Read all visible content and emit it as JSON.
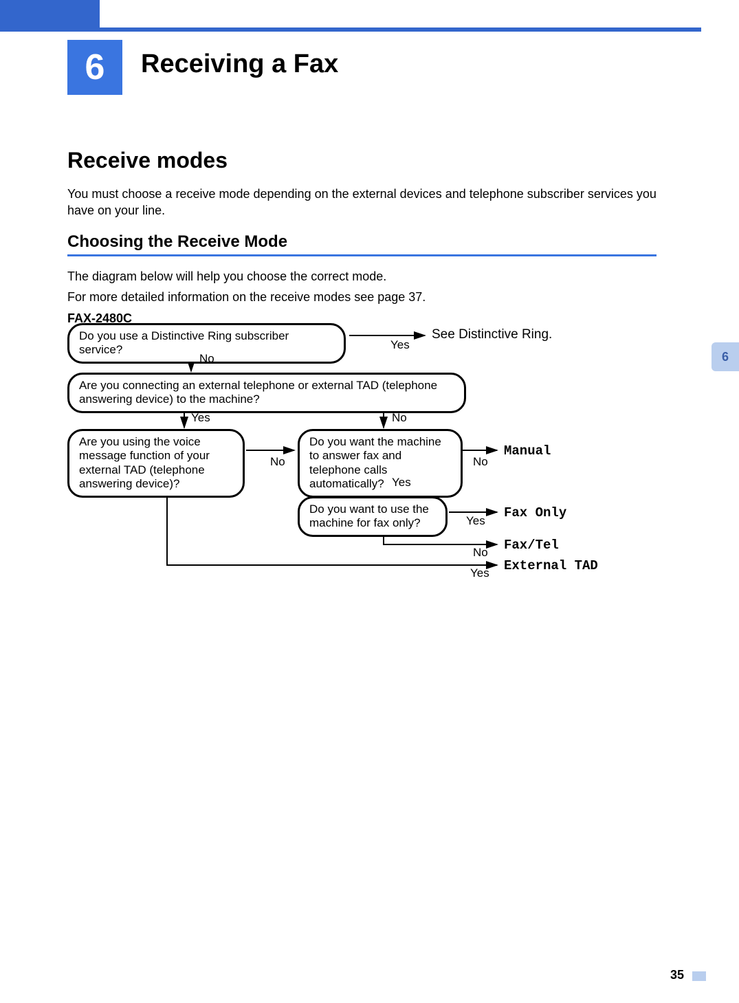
{
  "chapter": {
    "number": "6",
    "title": "Receiving a Fax"
  },
  "h2": "Receive modes",
  "intro": "You must choose a receive mode depending on the external devices and telephone subscriber services you have on your line.",
  "h3": "Choosing the Receive Mode",
  "p1": "The diagram below will help you choose the correct mode.",
  "p2": "For more detailed information on the receive modes see page 37.",
  "model": "FAX-2480C",
  "side_tab": "6",
  "page_number": "35",
  "flow": {
    "q1": "Do you use a Distinctive Ring subscriber service?",
    "q1_yes": "Yes",
    "q1_result": "See Distinctive Ring.",
    "q1_no": "No",
    "q2": "Are you connecting an external telephone or external TAD (telephone answering device) to the machine?",
    "q2_yes": "Yes",
    "q2_no": "No",
    "q3": "Are you using the voice message function of your external TAD (telephone answering device)?",
    "q3_no": "No",
    "q4": "Do you want the machine to answer fax and telephone calls automatically?",
    "q4_no": "No",
    "q4_result": "Manual",
    "q4_yes": "Yes",
    "q5": "Do you want to use the machine for fax only?",
    "q5_yes": "Yes",
    "q5_result": "Fax Only",
    "q5_no": "No",
    "faxtel": "Fax/Tel",
    "exttad_yes": "Yes",
    "exttad": "External TAD"
  }
}
